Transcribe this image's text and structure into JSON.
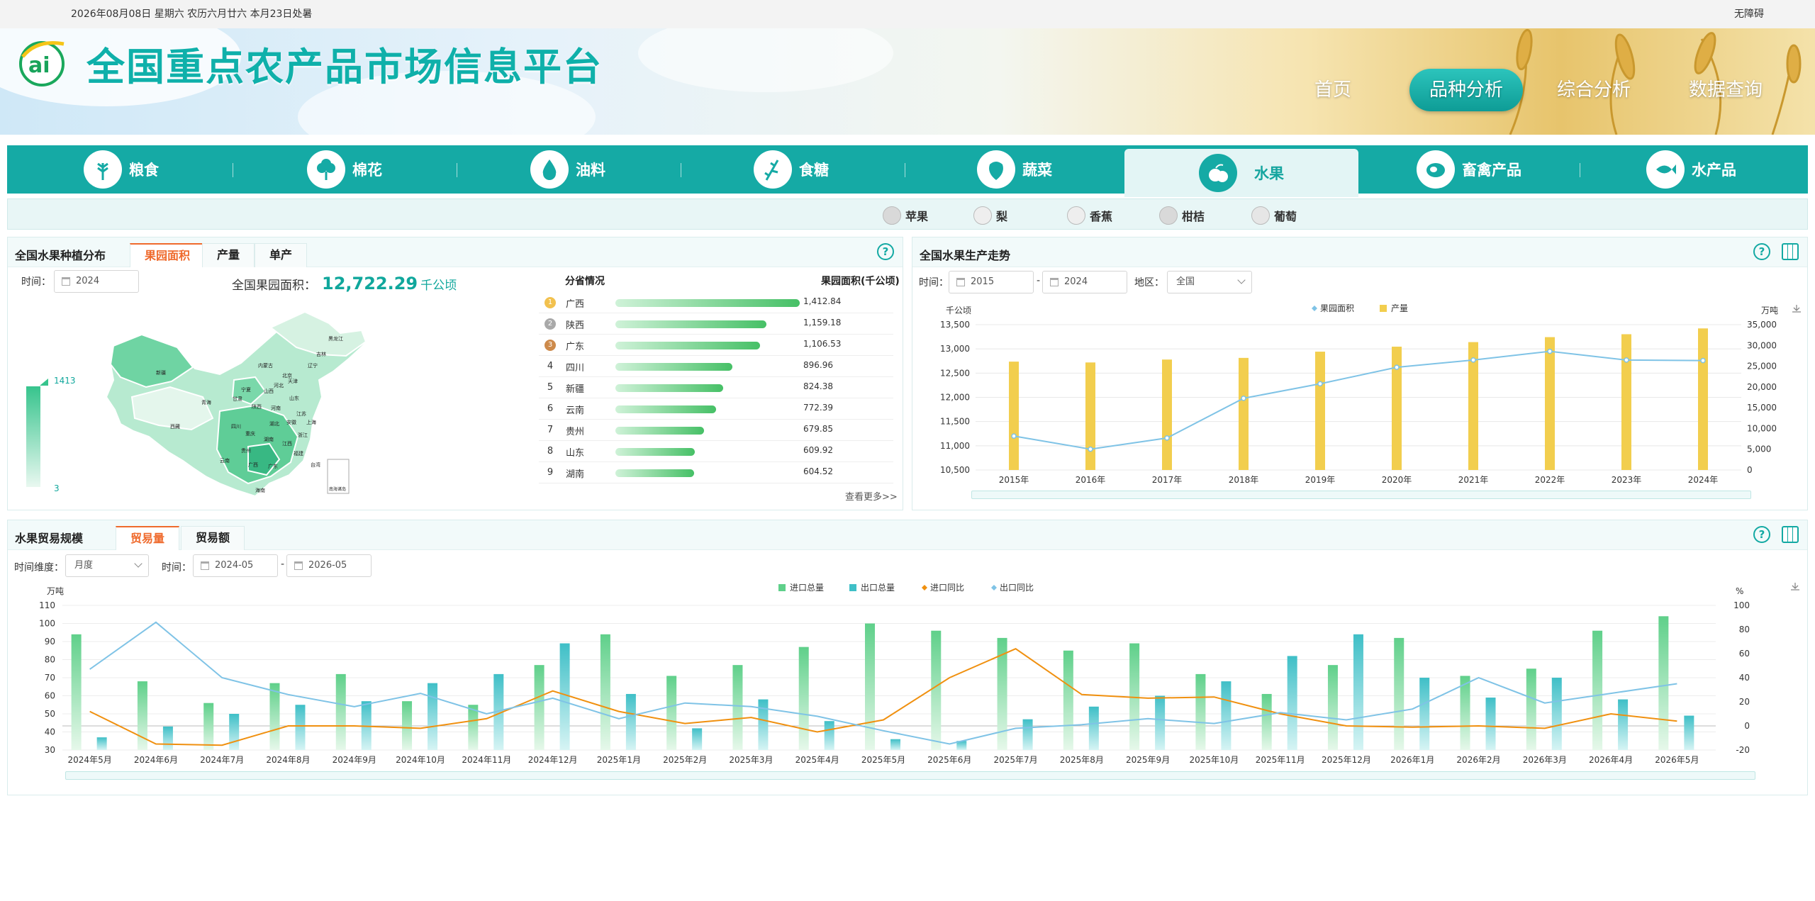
{
  "topbar": {
    "date": "2026年08月08日 星期六 农历六月廿六 本月23日处暑",
    "accessibility": "无障碍"
  },
  "header": {
    "title": "全国重点农产品市场信息平台",
    "logo_text": "ai",
    "nav": [
      {
        "label": "首页"
      },
      {
        "label": "品种分析"
      },
      {
        "label": "综合分析"
      },
      {
        "label": "数据查询"
      }
    ]
  },
  "categories": [
    {
      "label": "粮食",
      "icon": "grain-icon"
    },
    {
      "label": "棉花",
      "icon": "cotton-icon"
    },
    {
      "label": "油料",
      "icon": "oil-drop-icon"
    },
    {
      "label": "食糖",
      "icon": "sugar-cane-icon"
    },
    {
      "label": "蔬菜",
      "icon": "vegetable-icon"
    },
    {
      "label": "水果",
      "icon": "fruit-icon"
    },
    {
      "label": "畜禽产品",
      "icon": "meat-icon"
    },
    {
      "label": "水产品",
      "icon": "fish-icon"
    }
  ],
  "subcategories": [
    {
      "label": "苹果"
    },
    {
      "label": "梨"
    },
    {
      "label": "香蕉"
    },
    {
      "label": "柑桔"
    },
    {
      "label": "葡萄"
    }
  ],
  "distribution": {
    "title": "全国水果种植分布",
    "tabs": [
      {
        "label": "果园面积"
      },
      {
        "label": "产量"
      },
      {
        "label": "单产"
      }
    ],
    "time_label": "时间：",
    "time_value": "2024",
    "total_label": "全国果园面积：",
    "total_value": "12,722.29",
    "total_unit": "千公顷",
    "legend_max": "1413",
    "legend_min": "3",
    "map_labels": [
      "黑龙江",
      "吉林",
      "辽宁",
      "内蒙古",
      "北京",
      "天津",
      "河北",
      "山西",
      "宁夏",
      "甘肃",
      "陕西",
      "河南",
      "山东",
      "江苏",
      "上海",
      "安徽",
      "湖北",
      "浙江",
      "四川",
      "重庆",
      "湖南",
      "江西",
      "福建",
      "贵州",
      "云南",
      "广西",
      "广东",
      "台湾",
      "海南",
      "新疆",
      "西藏",
      "青海",
      "南海诸岛"
    ],
    "ranking_header": "分省情况",
    "value_header": "果园面积(千公顷)",
    "ranking": [
      {
        "rank": "1",
        "name": "广西",
        "value": "1,412.84",
        "v": 1412.84
      },
      {
        "rank": "2",
        "name": "陕西",
        "value": "1,159.18",
        "v": 1159.18
      },
      {
        "rank": "3",
        "name": "广东",
        "value": "1,106.53",
        "v": 1106.53
      },
      {
        "rank": "4",
        "name": "四川",
        "value": "896.96",
        "v": 896.96
      },
      {
        "rank": "5",
        "name": "新疆",
        "value": "824.38",
        "v": 824.38
      },
      {
        "rank": "6",
        "name": "云南",
        "value": "772.39",
        "v": 772.39
      },
      {
        "rank": "7",
        "name": "贵州",
        "value": "679.85",
        "v": 679.85
      },
      {
        "rank": "8",
        "name": "山东",
        "value": "609.92",
        "v": 609.92
      },
      {
        "rank": "9",
        "name": "湖南",
        "value": "604.52",
        "v": 604.52
      }
    ],
    "more": "查看更多>>"
  },
  "trend": {
    "title": "全国水果生产走势",
    "time_label": "时间：",
    "start": "2015",
    "dash": "-",
    "end": "2024",
    "region_label": "地区：",
    "region": "全国"
  },
  "trade": {
    "title": "水果贸易规模",
    "tabs": [
      {
        "label": "贸易量"
      },
      {
        "label": "贸易额"
      }
    ],
    "dim_label": "时间维度：",
    "dim": "月度",
    "time_label": "时间：",
    "start": "2024-05",
    "dash": "-",
    "end": "2026-05"
  },
  "chart_data": [
    {
      "type": "bar+line",
      "categories": [
        "2015年",
        "2016年",
        "2017年",
        "2018年",
        "2019年",
        "2020年",
        "2021年",
        "2022年",
        "2023年",
        "2024年"
      ],
      "series": [
        {
          "name": "果园面积",
          "axis": "left",
          "type": "line",
          "values": [
            11200,
            10930,
            11160,
            11980,
            12280,
            12620,
            12770,
            12950,
            12770,
            12760
          ]
        },
        {
          "name": "产量",
          "axis": "right",
          "type": "bar",
          "values": [
            26100,
            25900,
            26600,
            27000,
            28500,
            29700,
            30800,
            32000,
            32700,
            34100
          ]
        }
      ],
      "ylabel_left": "千公顷",
      "ylabel_right": "万吨",
      "ylim_left": [
        10500,
        13500
      ],
      "ylim_right": [
        0,
        35000
      ],
      "yticks_left": [
        "10,500",
        "11,000",
        "11,500",
        "12,000",
        "12,500",
        "13,000",
        "13,500"
      ],
      "yticks_right": [
        "0",
        "5,000",
        "10,000",
        "15,000",
        "20,000",
        "25,000",
        "30,000",
        "35,000"
      ],
      "legend": "top-center",
      "grid": true
    },
    {
      "type": "bar+line",
      "categories": [
        "2024年5月",
        "2024年6月",
        "2024年7月",
        "2024年8月",
        "2024年9月",
        "2024年10月",
        "2024年11月",
        "2024年12月",
        "2025年1月",
        "2025年2月",
        "2025年3月",
        "2025年4月",
        "2025年5月",
        "2025年6月",
        "2025年7月",
        "2025年8月",
        "2025年9月",
        "2025年10月",
        "2025年11月",
        "2025年12月",
        "2026年1月",
        "2026年2月",
        "2026年3月",
        "2026年4月",
        "2026年5月"
      ],
      "series": [
        {
          "name": "进口总量",
          "axis": "left",
          "type": "bar",
          "values": [
            94,
            68,
            56,
            67,
            72,
            57,
            55,
            77,
            94,
            71,
            77,
            87,
            100,
            96,
            92,
            85,
            89,
            72,
            61,
            77,
            92,
            71,
            75,
            96,
            104
          ]
        },
        {
          "name": "出口总量",
          "axis": "left",
          "type": "bar",
          "values": [
            37,
            43,
            50,
            55,
            57,
            67,
            72,
            89,
            61,
            42,
            58,
            46,
            36,
            35,
            47,
            54,
            60,
            68,
            82,
            94,
            70,
            59,
            70,
            58,
            49
          ]
        },
        {
          "name": "进口同比",
          "axis": "right",
          "type": "line",
          "values": [
            12,
            -15,
            -16,
            0,
            0,
            -2,
            6,
            29,
            12,
            2,
            7,
            -5,
            5,
            40,
            64,
            26,
            23,
            24,
            10,
            0,
            -1,
            0,
            -2,
            10,
            4
          ]
        },
        {
          "name": "出口同比",
          "axis": "right",
          "type": "line",
          "values": [
            47,
            86,
            40,
            26,
            16,
            27,
            10,
            23,
            6,
            19,
            16,
            8,
            -4,
            -15,
            -2,
            1,
            6,
            2,
            11,
            5,
            14,
            40,
            19,
            27,
            35
          ]
        }
      ],
      "ylabel_left": "万吨",
      "ylabel_right": "%",
      "ylim_left": [
        30,
        110
      ],
      "ylim_right": [
        -20,
        100
      ],
      "yticks_left": [
        "30",
        "40",
        "50",
        "60",
        "70",
        "80",
        "90",
        "100",
        "110"
      ],
      "yticks_right": [
        "-20",
        "0",
        "20",
        "40",
        "60",
        "80",
        "100"
      ],
      "legend": "top-center",
      "grid": true
    }
  ],
  "colors": {
    "primary": "#15aaa5",
    "accent": "#ef6a2c",
    "bar_yellow": "#f2ce4e",
    "line_blue": "#7fc3e6",
    "green": "#5fd08a",
    "teal": "#4fc6cc",
    "orange": "#f0900f"
  }
}
